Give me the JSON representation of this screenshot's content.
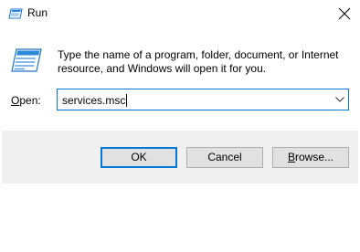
{
  "window": {
    "title": "Run",
    "icon": "run-icon",
    "close_icon": "close-icon"
  },
  "description": {
    "line1": "Type the name of a program, folder, document, or Internet",
    "line2": "resource, and Windows will open it for you."
  },
  "open_field": {
    "label_mnemonic": "O",
    "label_rest": "pen:",
    "value": "services.msc",
    "dropdown_icon": "chevron-down-icon",
    "focus_color": "#0078d7"
  },
  "buttons": {
    "ok": "OK",
    "cancel": "Cancel",
    "browse_mnemonic": "B",
    "browse_rest": "rowse..."
  }
}
